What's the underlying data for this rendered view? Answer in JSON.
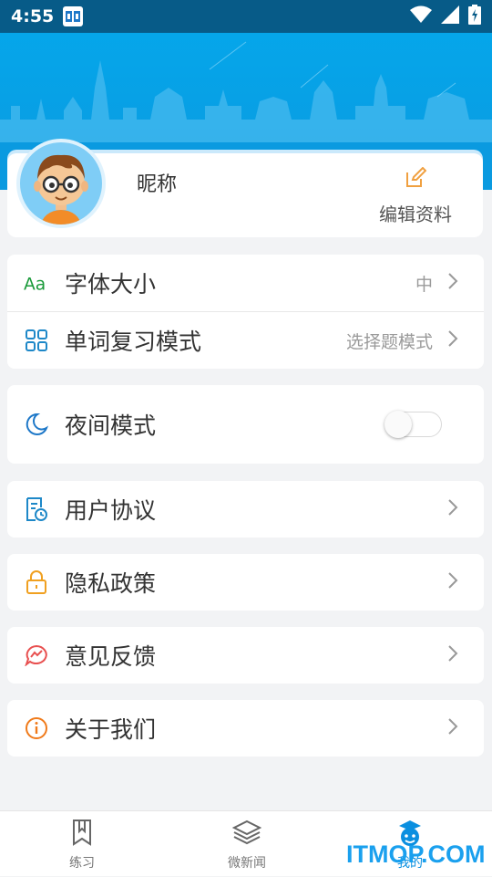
{
  "status_bar": {
    "time": "4:55",
    "icons": [
      "app-notification-icon",
      "wifi-icon",
      "signal-icon",
      "battery-charging-icon"
    ]
  },
  "profile": {
    "nickname": "昵称",
    "edit_label": "编辑资料",
    "avatar_icon": "cartoon-boy-avatar"
  },
  "settings": {
    "font_size": {
      "label": "字体大小",
      "value": "中",
      "icon": "font-aa-icon"
    },
    "review_mode": {
      "label": "单词复习模式",
      "value": "选择题模式",
      "icon": "grid-icon"
    },
    "night_mode": {
      "label": "夜间模式",
      "enabled": false,
      "icon": "moon-icon"
    }
  },
  "links": {
    "user_agreement": {
      "label": "用户协议",
      "icon": "document-clock-icon"
    },
    "privacy_policy": {
      "label": "隐私政策",
      "icon": "lock-icon"
    },
    "feedback": {
      "label": "意见反馈",
      "icon": "chat-bubble-icon"
    },
    "about_us": {
      "label": "关于我们",
      "icon": "info-icon"
    }
  },
  "tabs": [
    {
      "label": "练习",
      "icon": "bookmark-icon",
      "active": false
    },
    {
      "label": "微新闻",
      "icon": "layers-icon",
      "active": false
    },
    {
      "label": "我的",
      "icon": "mascot-icon",
      "active": true
    }
  ],
  "watermark": "ITMOP.COM",
  "colors": {
    "header_blue": "#05a6ea",
    "status_bar": "#075b88",
    "tab_active": "#0a8fe0",
    "font_icon_green": "#1a9a3a",
    "grid_icon_blue": "#1e88c8",
    "lock_icon_orange": "#f0a020",
    "feedback_icon_red": "#e85050",
    "info_icon_orange": "#f07a1a"
  }
}
